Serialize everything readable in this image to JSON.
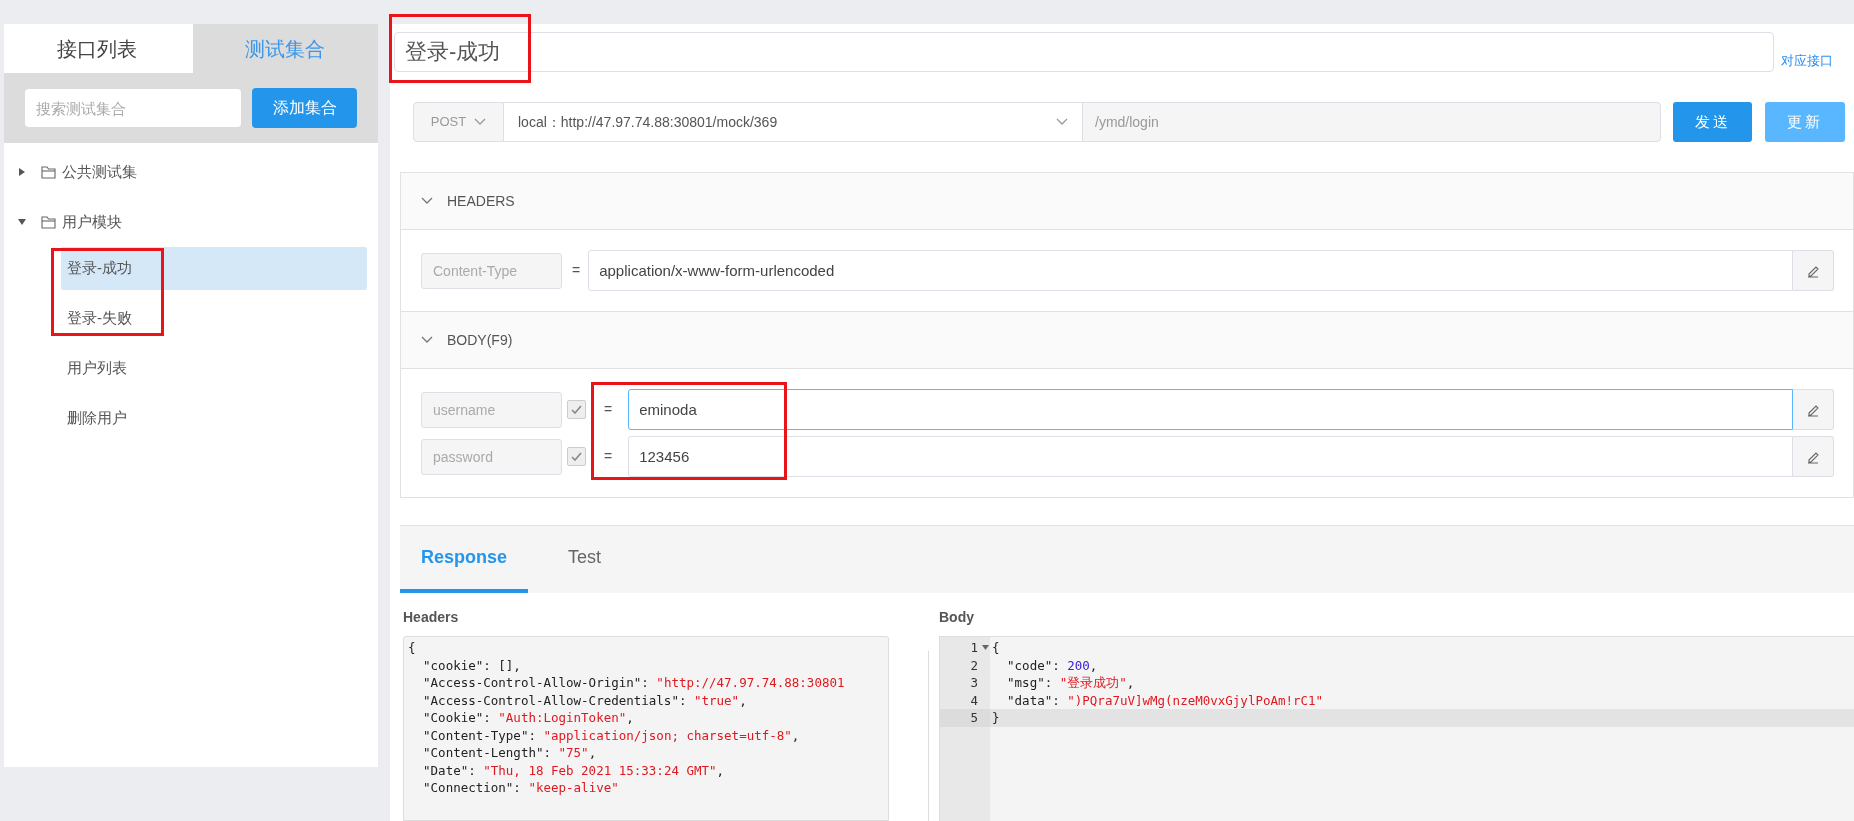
{
  "sidebar": {
    "tabs": [
      {
        "label": "接口列表",
        "selected": false
      },
      {
        "label": "测试集合",
        "selected": true
      }
    ],
    "search": {
      "placeholder": "搜索测试集合"
    },
    "add_button": "添加集合",
    "tree": [
      {
        "label": "公共测试集",
        "expanded": false
      },
      {
        "label": "用户模块",
        "expanded": true,
        "children": [
          {
            "label": "登录-成功",
            "selected": true,
            "highlighted": true
          },
          {
            "label": "登录-失败",
            "selected": false,
            "highlighted": true
          },
          {
            "label": "用户列表",
            "selected": false,
            "highlighted": false
          },
          {
            "label": "删除用户",
            "selected": false,
            "highlighted": false
          }
        ]
      }
    ]
  },
  "title": {
    "value": "登录-成功",
    "highlighted": true
  },
  "linked_api_link": "对应接口",
  "request": {
    "method": "POST",
    "environment": "local：http://47.97.74.88:30801/mock/369",
    "path": "/ymd/login",
    "send_button": "发送",
    "update_button": "更新"
  },
  "headers": {
    "title": "HEADERS",
    "expanded": true,
    "rows": [
      {
        "key": "Content-Type",
        "operator": "=",
        "value": "application/x-www-form-urlencoded"
      }
    ]
  },
  "body": {
    "title": "BODY(F9)",
    "expanded": true,
    "highlighted": true,
    "rows": [
      {
        "key": "username",
        "checked": true,
        "operator": "=",
        "value": "eminoda",
        "focused": true
      },
      {
        "key": "password",
        "checked": true,
        "operator": "=",
        "value": "123456",
        "focused": false
      }
    ]
  },
  "response": {
    "tabs": [
      {
        "label": "Response",
        "selected": true
      },
      {
        "label": "Test",
        "selected": false
      }
    ],
    "headers_label": "Headers",
    "headers_code": [
      [
        {
          "kind": "plain",
          "text": "{"
        }
      ],
      [
        {
          "kind": "plain",
          "text": "  \"cookie\": [],"
        }
      ],
      [
        {
          "kind": "plain",
          "text": "  \"Access-Control-Allow-Origin\": "
        },
        {
          "kind": "string",
          "text": "\"http://47.97.74.88:30801"
        }
      ],
      [
        {
          "kind": "plain",
          "text": "  \"Access-Control-Allow-Credentials\": "
        },
        {
          "kind": "string",
          "text": "\"true\""
        },
        {
          "kind": "plain",
          "text": ","
        }
      ],
      [
        {
          "kind": "plain",
          "text": "  \"Cookie\": "
        },
        {
          "kind": "string",
          "text": "\"Auth:LoginToken\""
        },
        {
          "kind": "plain",
          "text": ","
        }
      ],
      [
        {
          "kind": "plain",
          "text": "  \"Content-Type\": "
        },
        {
          "kind": "string",
          "text": "\"application/json; charset=utf-8\""
        },
        {
          "kind": "plain",
          "text": ","
        }
      ],
      [
        {
          "kind": "plain",
          "text": "  \"Content-Length\": "
        },
        {
          "kind": "string",
          "text": "\"75\""
        },
        {
          "kind": "plain",
          "text": ","
        }
      ],
      [
        {
          "kind": "plain",
          "text": "  \"Date\": "
        },
        {
          "kind": "string",
          "text": "\"Thu, 18 Feb 2021 15:33:24 GMT\""
        },
        {
          "kind": "plain",
          "text": ","
        }
      ],
      [
        {
          "kind": "plain",
          "text": "  \"Connection\": "
        },
        {
          "kind": "string",
          "text": "\"keep-alive\""
        }
      ]
    ],
    "body_label": "Body",
    "body_code": [
      {
        "number": "1",
        "foldable": true,
        "active": false,
        "tokens": [
          {
            "kind": "plain",
            "text": "{"
          }
        ]
      },
      {
        "number": "2",
        "foldable": false,
        "active": false,
        "tokens": [
          {
            "kind": "plain",
            "text": "  \"code\": "
          },
          {
            "kind": "number",
            "text": "200"
          },
          {
            "kind": "plain",
            "text": ","
          }
        ]
      },
      {
        "number": "3",
        "foldable": false,
        "active": false,
        "tokens": [
          {
            "kind": "plain",
            "text": "  \"msg\": "
          },
          {
            "kind": "string",
            "text": "\"登录成功\""
          },
          {
            "kind": "plain",
            "text": ","
          }
        ]
      },
      {
        "number": "4",
        "foldable": false,
        "active": false,
        "tokens": [
          {
            "kind": "plain",
            "text": "  \"data\": "
          },
          {
            "kind": "string",
            "text": "\")PQra7uV]wMg(nzeM0vxGjylPoAm!rC1\""
          }
        ]
      },
      {
        "number": "5",
        "foldable": false,
        "active": true,
        "tokens": [
          {
            "kind": "plain",
            "text": "}"
          }
        ]
      }
    ]
  }
}
